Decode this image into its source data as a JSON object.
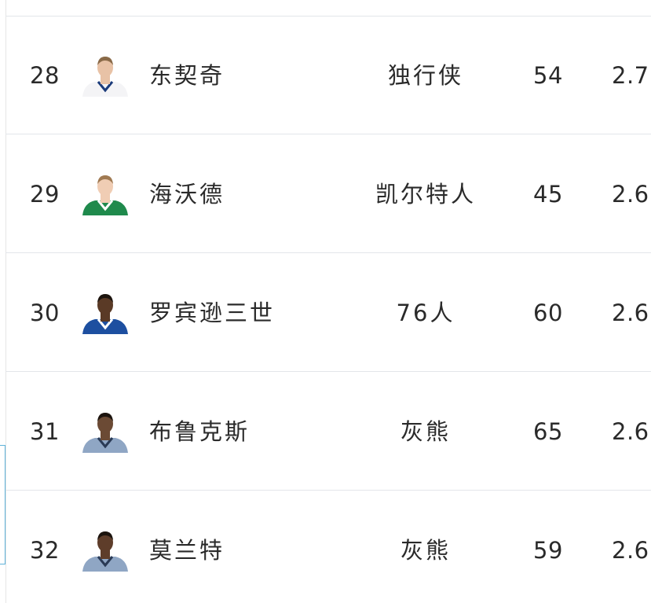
{
  "rows": [
    {
      "rank": "28",
      "name": "东契奇",
      "team": "独行侠",
      "games": "54",
      "avg": "2.7",
      "jersey": "#f4f4f6",
      "trim": "#1b3b7a",
      "skin": "#e8c2a6",
      "hair": "#8a6a48"
    },
    {
      "rank": "29",
      "name": "海沃德",
      "team": "凯尔特人",
      "games": "45",
      "avg": "2.6",
      "jersey": "#1f8a4c",
      "trim": "#ffffff",
      "skin": "#f0cdb4",
      "hair": "#a07a52"
    },
    {
      "rank": "30",
      "name": "罗宾逊三世",
      "team": "76人",
      "games": "60",
      "avg": "2.6",
      "jersey": "#1d4fa0",
      "trim": "#ffffff",
      "skin": "#5a3a26",
      "hair": "#1c140e"
    },
    {
      "rank": "31",
      "name": "布鲁克斯",
      "team": "灰熊",
      "games": "65",
      "avg": "2.6",
      "jersey": "#8fa6c4",
      "trim": "#2a3a55",
      "skin": "#6b4a34",
      "hair": "#1c140e"
    },
    {
      "rank": "32",
      "name": "莫兰特",
      "team": "灰熊",
      "games": "59",
      "avg": "2.6",
      "jersey": "#8fa6c4",
      "trim": "#2a3a55",
      "skin": "#5e3d2a",
      "hair": "#1c140e"
    }
  ]
}
